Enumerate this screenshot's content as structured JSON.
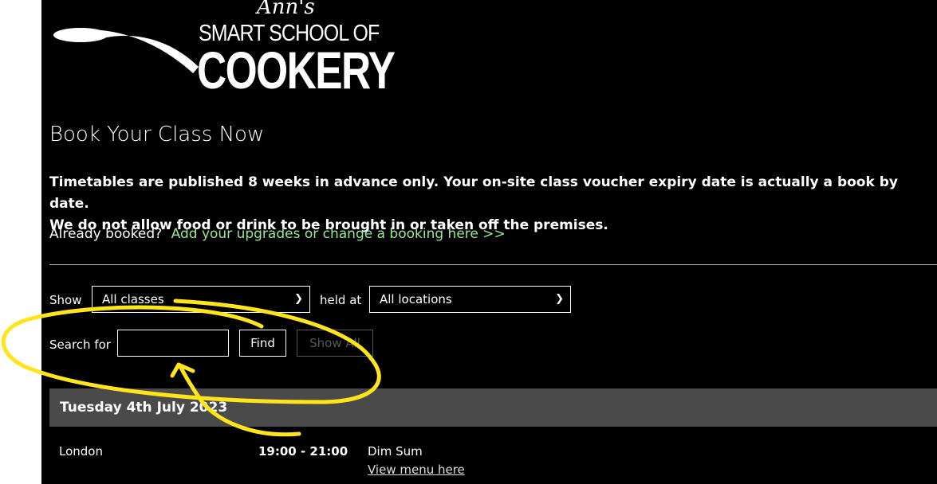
{
  "logo": {
    "script": "Ann's",
    "line1": "SMART SCHOOL OF",
    "line2": "COOKERY",
    "icon": "spoon-icon"
  },
  "page_title": "Book Your Class Now",
  "notice": {
    "line1": "Timetables are published 8 weeks in advance only.  Your on-site class voucher expiry date is actually a book by date.",
    "line2": "We do not allow food or drink to be brought in or taken off the premises."
  },
  "booked": {
    "prompt": "Already booked?",
    "link": "Add your upgrades or change a booking here >>"
  },
  "filters": {
    "show_label": "Show",
    "show_value": "All classes",
    "held_label": "held at",
    "location_value": "All locations",
    "search_label": "Search for",
    "search_value": "",
    "find_label": "Find",
    "show_all_label": "Show All"
  },
  "schedule": {
    "date": "Tuesday 4th July 2023",
    "rows": [
      {
        "location": "London",
        "time": "19:00 - 21:00",
        "class": "Dim Sum",
        "link": "View menu here"
      }
    ]
  },
  "colors": {
    "background": "#000000",
    "link": "#9ae89a",
    "date_bar": "#4a4a4a",
    "annotation": "#ffe51a"
  }
}
